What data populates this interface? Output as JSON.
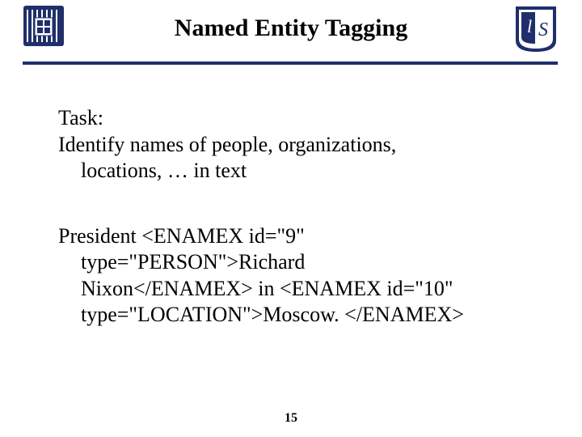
{
  "header": {
    "title": "Named Entity Tagging",
    "logo_left_name": "stripe-shield-logo",
    "logo_right_name": "ls-logo"
  },
  "body": {
    "para1": {
      "line1": "Task:",
      "line2": "Identify names of people, organizations,",
      "line3": "locations, … in text"
    },
    "para2": {
      "l1": "President <ENAMEX id=\"9\"",
      "l2": "type=\"PERSON\">Richard",
      "l3": "Nixon</ENAMEX> in <ENAMEX id=\"10\"",
      "l4": "type=\"LOCATION\">Moscow. </ENAMEX>"
    }
  },
  "page_number": "15"
}
